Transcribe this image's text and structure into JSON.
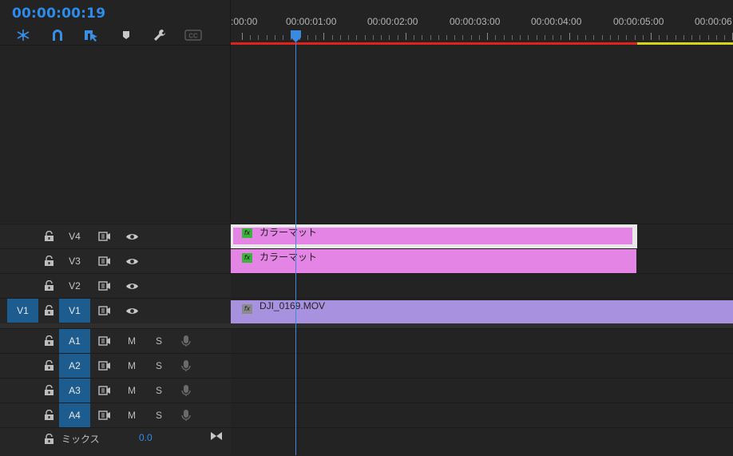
{
  "timecode": "00:00:00:19",
  "tools": [
    {
      "name": "snap-nested-icon"
    },
    {
      "name": "magnet-icon"
    },
    {
      "name": "linked-selection-icon"
    },
    {
      "name": "add-marker-icon"
    },
    {
      "name": "wrench-icon"
    },
    {
      "name": "captions-icon",
      "label": "CC"
    }
  ],
  "ruler": {
    "labels": [
      ":00:00",
      "00:00:01:00",
      "00:00:02:00",
      "00:00:03:00",
      "00:00:04:00",
      "00:00:05:00",
      "00:00:06"
    ]
  },
  "video_tracks": [
    {
      "name": "V4"
    },
    {
      "name": "V3"
    },
    {
      "name": "V2"
    },
    {
      "name": "V1",
      "source": "V1"
    }
  ],
  "audio_tracks": [
    {
      "name": "A1",
      "mute": "M",
      "solo": "S"
    },
    {
      "name": "A2",
      "mute": "M",
      "solo": "S"
    },
    {
      "name": "A3",
      "mute": "M",
      "solo": "S"
    },
    {
      "name": "A4",
      "mute": "M",
      "solo": "S"
    }
  ],
  "clips": {
    "v4": {
      "label": "カラーマット",
      "fx": "fx"
    },
    "v3": {
      "label": "カラーマット",
      "fx": "fx"
    },
    "v1": {
      "label": "DJI_0169.MOV",
      "fx": "fx"
    }
  },
  "mix": {
    "label": "ミックス",
    "value": "0.0"
  },
  "colors": {
    "accent": "#2d8ceb",
    "track_selected": "#1d5c8f",
    "color_matte_clip": "#e484e4",
    "video_clip": "#a892e0",
    "workarea_red": "#e0221c",
    "workarea_yellow": "#d7d21a"
  }
}
